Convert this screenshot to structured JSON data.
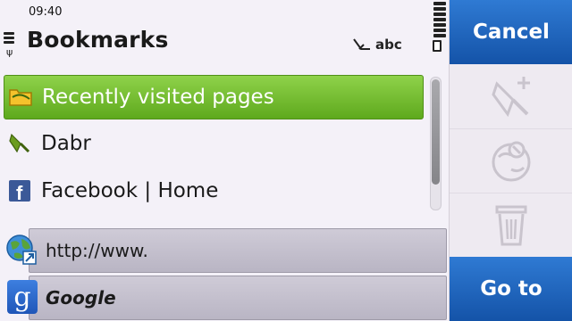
{
  "status": {
    "time": "09:40",
    "signal_glyph": "🅇"
  },
  "header": {
    "title": "Bookmarks",
    "input_mode": "abc"
  },
  "list": {
    "items": [
      {
        "label": "Recently visited pages",
        "icon": "folder-icon",
        "selected": true
      },
      {
        "label": "Dabr",
        "icon": "bookmark-tag-icon",
        "selected": false
      },
      {
        "label": "Facebook | Home",
        "icon": "facebook-icon",
        "selected": false
      }
    ],
    "web_items": [
      {
        "label": "http://www.",
        "icon": "globe-link-icon"
      },
      {
        "label": "Google",
        "icon": "google-icon"
      }
    ]
  },
  "toolbar": {
    "cancel_label": "Cancel",
    "goto_label": "Go to",
    "icons": [
      "add-bookmark-icon",
      "sync-bookmark-icon",
      "trash-icon"
    ]
  },
  "colors": {
    "accent_blue": "#1f64bd",
    "selection_green": "#6fb82a"
  }
}
